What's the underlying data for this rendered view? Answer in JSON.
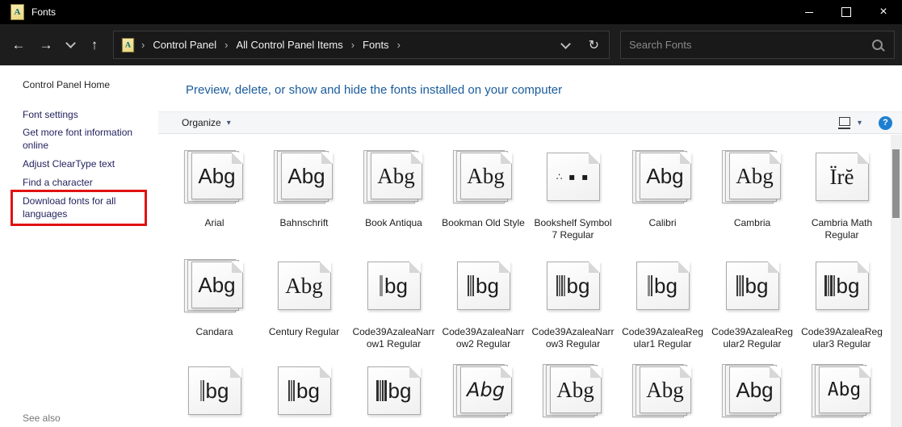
{
  "window": {
    "title": "Fonts"
  },
  "icons": {
    "back": "←",
    "forward": "→",
    "up": "↑",
    "refresh": "↻",
    "crumb_sep": "›",
    "caret": "▾",
    "close": "×",
    "help": "?",
    "app_letter": "A"
  },
  "navbar": {
    "breadcrumb": [
      "Control Panel",
      "All Control Panel Items",
      "Fonts"
    ],
    "search_placeholder": "Search Fonts"
  },
  "sidebar": {
    "home": "Control Panel Home",
    "links": [
      "Font settings",
      "Get more font information online",
      "Adjust ClearType text",
      "Find a character",
      "Download fonts for all languages"
    ],
    "highlighted_link": "Download fonts for all languages",
    "see_also": "See also"
  },
  "main": {
    "heading": "Preview, delete, or show and hide the fonts installed on your computer",
    "toolbar": {
      "organize": "Organize"
    }
  },
  "grid": {
    "tiles": [
      {
        "label": "Arial",
        "stacked": true,
        "glyph": "Abg",
        "style": "sans"
      },
      {
        "label": "Bahnschrift",
        "stacked": true,
        "glyph": "Abg",
        "style": "sans"
      },
      {
        "label": "Book Antiqua",
        "stacked": true,
        "glyph": "Abg",
        "style": "serif"
      },
      {
        "label": "Bookman Old Style",
        "stacked": true,
        "glyph": "Abg",
        "style": "serif"
      },
      {
        "label": "Bookshelf Symbol 7 Regular",
        "stacked": false,
        "glyph": "∴ ▪ ▪",
        "style": "symbol"
      },
      {
        "label": "Calibri",
        "stacked": true,
        "glyph": "Abg",
        "style": "sans"
      },
      {
        "label": "Cambria",
        "stacked": true,
        "glyph": "Abg",
        "style": "serif"
      },
      {
        "label": "Cambria Math Regular",
        "stacked": false,
        "glyph": "Ïrĕ",
        "style": "serif"
      },
      {
        "label": "Candara",
        "stacked": true,
        "glyph": "Abg",
        "style": "sans"
      },
      {
        "label": "Century Regular",
        "stacked": false,
        "glyph": "Abg",
        "style": "serif"
      },
      {
        "label": "Code39AzaleaNarrow1 Regular",
        "stacked": false,
        "glyph": "bg",
        "style": "sans",
        "bars": [
          {
            "w": 4,
            "c": "#909090"
          }
        ]
      },
      {
        "label": "Code39AzaleaNarrow2 Regular",
        "stacked": false,
        "glyph": "bg",
        "style": "sans",
        "bars": [
          {
            "w": 2,
            "c": "#3b3b3b"
          },
          {
            "w": 2,
            "c": "#6d6d6d"
          },
          {
            "w": 2,
            "c": "#3b3b3b"
          }
        ]
      },
      {
        "label": "Code39AzaleaNarrow3 Regular",
        "stacked": false,
        "glyph": "bg",
        "style": "sans",
        "bars": [
          {
            "w": 2,
            "c": "#3b3b3b"
          },
          {
            "w": 2,
            "c": "#6d6d6d"
          },
          {
            "w": 2,
            "c": "#3b3b3b"
          },
          {
            "w": 2,
            "c": "#6d6d6d"
          }
        ]
      },
      {
        "label": "Code39AzaleaRegular1 Regular",
        "stacked": false,
        "glyph": "bg",
        "style": "sans",
        "bars": [
          {
            "w": 3,
            "c": "#8a8a8a"
          },
          {
            "w": 2,
            "c": "#3b3b3b"
          }
        ]
      },
      {
        "label": "Code39AzaleaRegular2 Regular",
        "stacked": false,
        "glyph": "bg",
        "style": "sans",
        "bars": [
          {
            "w": 2,
            "c": "#3b3b3b"
          },
          {
            "w": 3,
            "c": "#777777"
          },
          {
            "w": 2,
            "c": "#3b3b3b"
          }
        ]
      },
      {
        "label": "Code39AzaleaRegular3 Regular",
        "stacked": false,
        "glyph": "bg",
        "style": "sans",
        "bars": [
          {
            "w": 3,
            "c": "#2e2e2e"
          },
          {
            "w": 2,
            "c": "#6d6d6d"
          },
          {
            "w": 3,
            "c": "#2e2e2e"
          },
          {
            "w": 2,
            "c": "#555555"
          }
        ]
      },
      {
        "label": "",
        "stacked": false,
        "glyph": "bg",
        "style": "sans",
        "bars": [
          {
            "w": 2,
            "c": "#8a8a8a"
          },
          {
            "w": 2,
            "c": "#4a4a4a"
          }
        ]
      },
      {
        "label": "",
        "stacked": false,
        "glyph": "bg",
        "style": "sans",
        "bars": [
          {
            "w": 2,
            "c": "#3b3b3b"
          },
          {
            "w": 2,
            "c": "#6d6d6d"
          },
          {
            "w": 2,
            "c": "#3b3b3b"
          }
        ]
      },
      {
        "label": "",
        "stacked": false,
        "glyph": "bg",
        "style": "sans",
        "bars": [
          {
            "w": 3,
            "c": "#2e2e2e"
          },
          {
            "w": 2,
            "c": "#666666"
          },
          {
            "w": 2,
            "c": "#2e2e2e"
          },
          {
            "w": 3,
            "c": "#2e2e2e"
          }
        ]
      },
      {
        "label": "",
        "stacked": true,
        "glyph": "Abg",
        "style": "comic"
      },
      {
        "label": "",
        "stacked": true,
        "glyph": "Abg",
        "style": "serif"
      },
      {
        "label": "",
        "stacked": true,
        "glyph": "Abg",
        "style": "serif"
      },
      {
        "label": "",
        "stacked": true,
        "glyph": "Abg",
        "style": "sans"
      },
      {
        "label": "",
        "stacked": true,
        "glyph": "Abg",
        "style": "mono"
      }
    ]
  },
  "colors": {
    "titlebar": "#000000",
    "navbar": "#1d1d1d",
    "sidebar_link": "#23235f",
    "heading": "#1a5b9c",
    "annotation_red": "#e01212",
    "help_blue": "#1e7fd0"
  }
}
